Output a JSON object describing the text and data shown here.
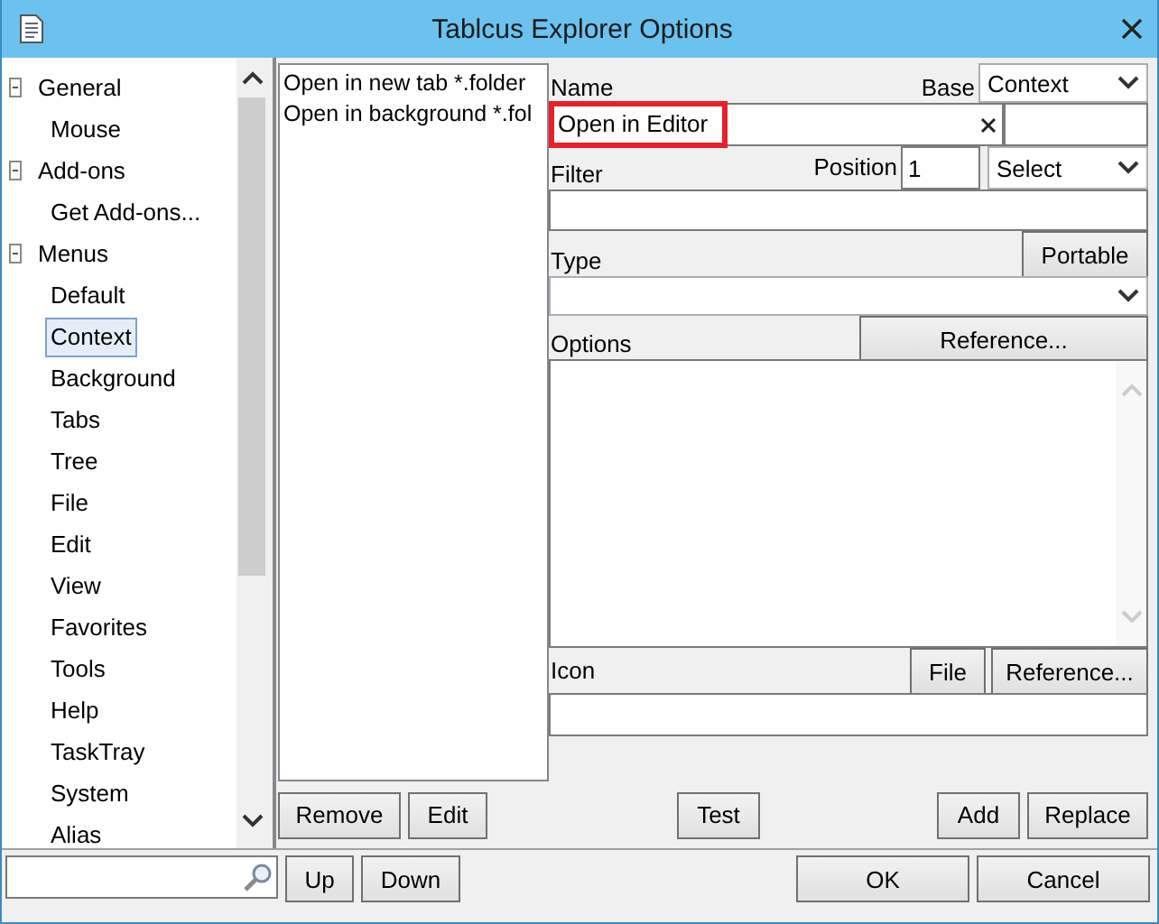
{
  "window": {
    "title": "Tablcus Explorer Options"
  },
  "tree": [
    {
      "label": "General",
      "expanded": true,
      "selected": false,
      "children": [
        {
          "label": "Mouse",
          "selected": false
        }
      ]
    },
    {
      "label": "Add-ons",
      "expanded": true,
      "selected": false,
      "children": [
        {
          "label": "Get Add-ons...",
          "selected": false
        }
      ]
    },
    {
      "label": "Menus",
      "expanded": true,
      "selected": false,
      "children": [
        {
          "label": "Default",
          "selected": false
        },
        {
          "label": "Context",
          "selected": true
        },
        {
          "label": "Background",
          "selected": false
        },
        {
          "label": "Tabs",
          "selected": false
        },
        {
          "label": "Tree",
          "selected": false
        },
        {
          "label": "File",
          "selected": false
        },
        {
          "label": "Edit",
          "selected": false
        },
        {
          "label": "View",
          "selected": false
        },
        {
          "label": "Favorites",
          "selected": false
        },
        {
          "label": "Tools",
          "selected": false
        },
        {
          "label": "Help",
          "selected": false
        },
        {
          "label": "TaskTray",
          "selected": false
        },
        {
          "label": "System",
          "selected": false
        },
        {
          "label": "Alias",
          "selected": false
        }
      ]
    }
  ],
  "menu_list": [
    "Open in new tab *.folder",
    "Open in background *.fol"
  ],
  "form": {
    "name_label": "Name",
    "base_label": "Base",
    "base_select": "Context",
    "name_value": "Open in Editor",
    "name_highlighted": true,
    "filter_label": "Filter",
    "position_label": "Position",
    "position_value": "1",
    "position_select": "Select",
    "type_label": "Type",
    "portable_button": "Portable",
    "options_label": "Options",
    "options_reference_button": "Reference...",
    "icon_label": "Icon",
    "file_button": "File",
    "icon_reference_button": "Reference..."
  },
  "list_buttons": [
    "Remove",
    "Edit"
  ],
  "test_button": "Test",
  "action_buttons": [
    "Add",
    "Replace"
  ],
  "nav_buttons": [
    "Up",
    "Down"
  ],
  "dialog_buttons": [
    "OK",
    "Cancel"
  ]
}
